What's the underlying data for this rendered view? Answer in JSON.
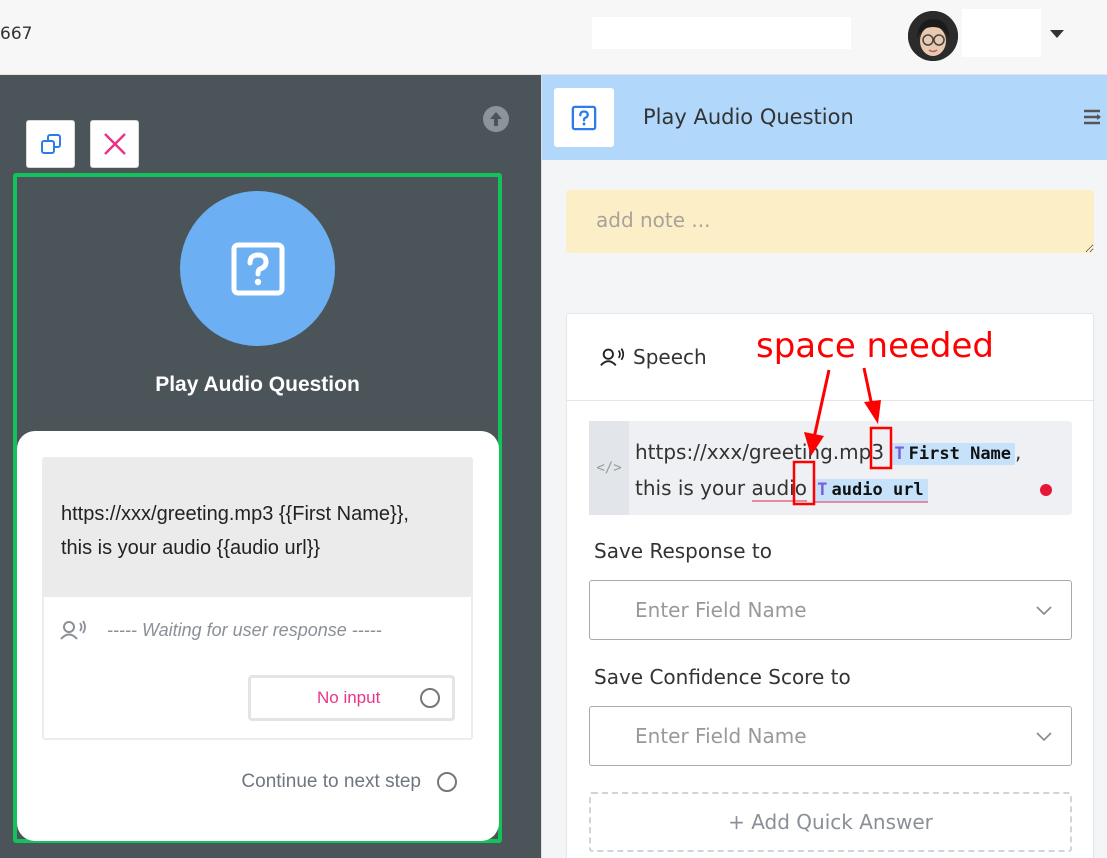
{
  "topbar": {
    "left_text": "667",
    "user_avatar_icon": "user-avatar-icon",
    "menu_caret_icon": "caret-down-icon"
  },
  "canvas": {
    "copy_icon": "copy-icon",
    "close_icon": "close-icon",
    "upload_icon": "arrow-up-circle-icon",
    "node_icon": "question-icon",
    "node_title": "Play Audio Question",
    "node_color": "#6cb0f3",
    "frame_color": "#14c25c",
    "message_line1": "https://xxx/greeting.mp3 {{First Name}},",
    "message_line2": "this is your audio {{audio url}}",
    "waiting_text": "----- Waiting for user response -----",
    "no_input_label": "No input",
    "continue_label": "Continue to next step"
  },
  "panel": {
    "title": "Play Audio Question",
    "header_color": "#b1d8fb",
    "note_placeholder": "add note ...",
    "speech_tab": "Speech",
    "editor": {
      "text_before": "https://xxx/greeting.mp3",
      "chip1_label": "First Name",
      "comma": ",",
      "text_mid": "this is your",
      "squiggle_word": "audio",
      "chip2_label": "audio url",
      "chip_icon": "T"
    },
    "save_response_label": "Save Response to",
    "save_response_placeholder": "Enter Field Name",
    "save_confidence_label": "Save Confidence Score to",
    "save_confidence_placeholder": "Enter Field Name",
    "add_quick_answer": "+ Add Quick Answer"
  },
  "annotation": {
    "text": "space needed",
    "color": "#ff0000"
  }
}
